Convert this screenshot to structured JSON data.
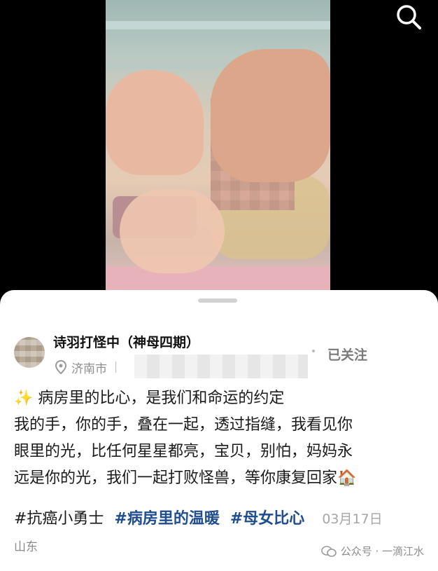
{
  "header": {
    "search_icon": "search-icon"
  },
  "author": {
    "name": "诗羽打怪中（神母四期）",
    "location": "济南市",
    "follow_label": "已关注"
  },
  "post": {
    "emoji": "✨",
    "line1": "病房里的比心，是我们和命运的约定",
    "line2": "我的手，你的手，叠在一起，透过指缝，我看见你",
    "line3": "眼里的光，比任何星星都亮，宝贝，别怕，妈妈永",
    "line4": "远是你的光，我们一起打败怪兽，等你康复回家🏠",
    "tag1": "#抗癌小勇士",
    "tag2": "#病房里的温暖",
    "tag3": "#母女比心",
    "date": "03月17日",
    "region": "山东"
  },
  "watermark": {
    "text": "公众号 · 一滴江水"
  },
  "colors": {
    "link": "#1f4d8f",
    "muted": "#8e8e8e",
    "background": "#000000"
  }
}
